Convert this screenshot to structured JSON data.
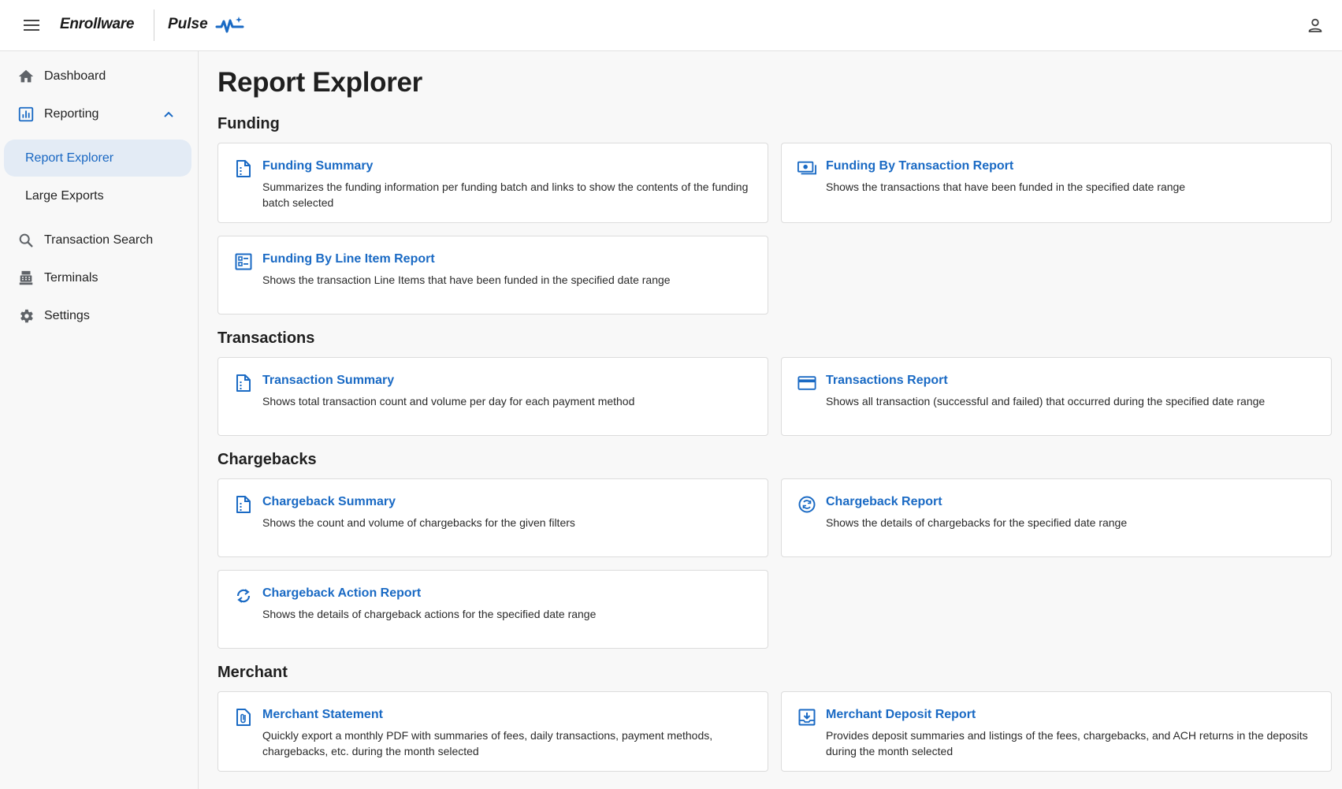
{
  "header": {
    "brand": "Enrollware",
    "product": "Pulse",
    "icons": {
      "menu": "hamburger-menu-icon",
      "pulse": "pulse-wave-icon",
      "account": "user-account-icon"
    }
  },
  "sidebar": {
    "items": [
      {
        "label": "Dashboard",
        "icon": "home-icon"
      },
      {
        "label": "Reporting",
        "icon": "bar-chart-icon",
        "expanded": true
      },
      {
        "label": "Report Explorer",
        "active": true
      },
      {
        "label": "Large Exports"
      },
      {
        "label": "Transaction Search",
        "icon": "search-icon"
      },
      {
        "label": "Terminals",
        "icon": "terminal-icon"
      },
      {
        "label": "Settings",
        "icon": "gear-icon"
      }
    ]
  },
  "main": {
    "title": "Report Explorer",
    "sections": [
      {
        "title": "Funding",
        "cards": [
          {
            "title": "Funding Summary",
            "desc": "Summarizes the funding information per funding batch and links to show the contents of the funding batch selected",
            "icon": "summary-document-icon"
          },
          {
            "title": "Funding By Transaction Report",
            "desc": "Shows the transactions that have been funded in the specified date range",
            "icon": "money-icon"
          },
          {
            "title": "Funding By Line Item Report",
            "desc": "Shows the transaction Line Items that have been funded in the specified date range",
            "icon": "line-items-icon"
          }
        ]
      },
      {
        "title": "Transactions",
        "cards": [
          {
            "title": "Transaction Summary",
            "desc": "Shows total transaction count and volume per day for each payment method",
            "icon": "summary-document-icon"
          },
          {
            "title": "Transactions Report",
            "desc": "Shows all transaction (successful and failed) that occurred during the specified date range",
            "icon": "credit-card-icon"
          }
        ]
      },
      {
        "title": "Chargebacks",
        "cards": [
          {
            "title": "Chargeback Summary",
            "desc": "Shows the count and volume of chargebacks for the given filters",
            "icon": "summary-document-icon"
          },
          {
            "title": "Chargeback Report",
            "desc": "Shows the details of chargebacks for the specified date range",
            "icon": "currency-exchange-icon"
          },
          {
            "title": "Chargeback Action Report",
            "desc": "Shows the details of chargeback actions for the specified date range",
            "icon": "sync-icon"
          }
        ]
      },
      {
        "title": "Merchant",
        "cards": [
          {
            "title": "Merchant Statement",
            "desc": "Quickly export a monthly PDF with summaries of fees, daily transactions, payment methods, chargebacks, etc. during the month selected",
            "icon": "paperclip-document-icon"
          },
          {
            "title": "Merchant Deposit Report",
            "desc": "Provides deposit summaries and listings of the fees, chargebacks, and ACH returns in the deposits during the month selected",
            "icon": "download-box-icon"
          }
        ]
      }
    ]
  },
  "colors": {
    "accent": "#1a6ac4",
    "active_bg": "#e3ebf5",
    "icon_gray": "#5f6368"
  }
}
